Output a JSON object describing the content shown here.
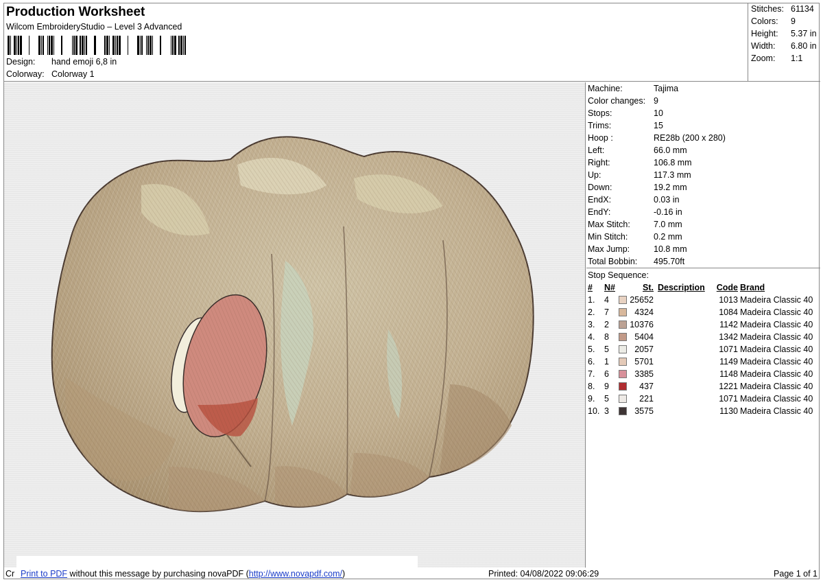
{
  "header": {
    "title": "Production Worksheet",
    "subtitle": "Wilcom EmbroideryStudio – Level 3 Advanced",
    "design_label": "Design:",
    "design_value": "hand emoji 6,8 in",
    "colorway_label": "Colorway:",
    "colorway_value": "Colorway 1"
  },
  "stats": [
    {
      "label": "Stitches:",
      "value": "61134"
    },
    {
      "label": "Colors:",
      "value": "9"
    },
    {
      "label": "Height:",
      "value": "5.37 in"
    },
    {
      "label": "Width:",
      "value": "6.80 in"
    },
    {
      "label": "Zoom:",
      "value": "1:1"
    }
  ],
  "machine": [
    {
      "label": "Machine:",
      "value": "Tajima"
    },
    {
      "label": "Color changes:",
      "value": "9"
    },
    {
      "label": "Stops:",
      "value": "10"
    },
    {
      "label": "Trims:",
      "value": "15"
    },
    {
      "label": "Hoop :",
      "value": "RE28b (200 x 280)"
    },
    {
      "label": "Left:",
      "value": "66.0 mm"
    },
    {
      "label": "Right:",
      "value": "106.8 mm"
    },
    {
      "label": "Up:",
      "value": "117.3 mm"
    },
    {
      "label": "Down:",
      "value": "19.2 mm"
    },
    {
      "label": "EndX:",
      "value": "0.03 in"
    },
    {
      "label": "EndY:",
      "value": "-0.16 in"
    },
    {
      "label": "Max Stitch:",
      "value": "7.0 mm"
    },
    {
      "label": "Min Stitch:",
      "value": "0.2 mm"
    },
    {
      "label": "Max Jump:",
      "value": "10.8 mm"
    },
    {
      "label": "Total Bobbin:",
      "value": "495.70ft"
    }
  ],
  "stop_sequence": {
    "title": "Stop Sequence:",
    "headers": {
      "idx": "#",
      "n": "N#",
      "st": "St.",
      "desc": "Description",
      "code": "Code",
      "brand": "Brand"
    },
    "rows": [
      {
        "idx": "1.",
        "n": "4",
        "color": "#e8d2c2",
        "st": "25652",
        "desc": "",
        "code": "1013",
        "brand": "Madeira Classic 40"
      },
      {
        "idx": "2.",
        "n": "7",
        "color": "#d8b89c",
        "st": "4324",
        "desc": "",
        "code": "1084",
        "brand": "Madeira Classic 40"
      },
      {
        "idx": "3.",
        "n": "2",
        "color": "#bca294",
        "st": "10376",
        "desc": "",
        "code": "1142",
        "brand": "Madeira Classic 40"
      },
      {
        "idx": "4.",
        "n": "8",
        "color": "#c29a88",
        "st": "5404",
        "desc": "",
        "code": "1342",
        "brand": "Madeira Classic 40"
      },
      {
        "idx": "5.",
        "n": "5",
        "color": "#ecece6",
        "st": "2057",
        "desc": "",
        "code": "1071",
        "brand": "Madeira Classic 40"
      },
      {
        "idx": "6.",
        "n": "1",
        "color": "#e4cab8",
        "st": "5701",
        "desc": "",
        "code": "1149",
        "brand": "Madeira Classic 40"
      },
      {
        "idx": "7.",
        "n": "6",
        "color": "#d8909a",
        "st": "3385",
        "desc": "",
        "code": "1148",
        "brand": "Madeira Classic 40"
      },
      {
        "idx": "8.",
        "n": "9",
        "color": "#b02c30",
        "st": "437",
        "desc": "",
        "code": "1221",
        "brand": "Madeira Classic 40"
      },
      {
        "idx": "9.",
        "n": "5",
        "color": "#eeeae6",
        "st": "221",
        "desc": "",
        "code": "1071",
        "brand": "Madeira Classic 40"
      },
      {
        "idx": "10.",
        "n": "3",
        "color": "#3e3434",
        "st": "3575",
        "desc": "",
        "code": "1130",
        "brand": "Madeira Classic 40"
      }
    ]
  },
  "footer": {
    "cut_text": "Cr",
    "pdf_link": "Print to PDF",
    "pdf_text_1": " without this message by purchasing novaPDF (",
    "pdf_url": "http://www.novapdf.com/",
    "pdf_text_2": ")",
    "printed": "Printed: 04/08/2022 09:06:29",
    "page": "Page 1 of 1"
  }
}
